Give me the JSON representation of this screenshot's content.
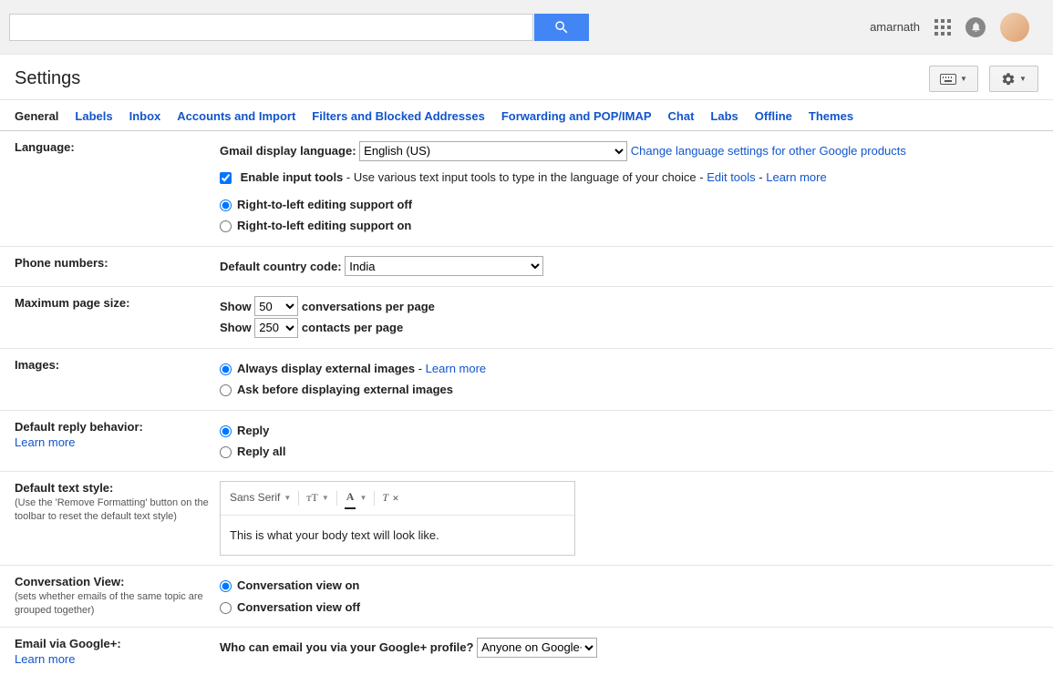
{
  "header": {
    "username": "amarnath"
  },
  "page": {
    "title": "Settings"
  },
  "tabs": [
    "General",
    "Labels",
    "Inbox",
    "Accounts and Import",
    "Filters and Blocked Addresses",
    "Forwarding and POP/IMAP",
    "Chat",
    "Labs",
    "Offline",
    "Themes"
  ],
  "language": {
    "label": "Language:",
    "display_label": "Gmail display language:",
    "display_value": "English (US)",
    "change_link": "Change language settings for other Google products",
    "enable_tools_label": "Enable input tools",
    "enable_tools_desc": " - Use various text input tools to type in the language of your choice - ",
    "edit_tools": "Edit tools",
    "learn_more": "Learn more",
    "rtl_off": "Right-to-left editing support off",
    "rtl_on": "Right-to-left editing support on"
  },
  "phone": {
    "label": "Phone numbers:",
    "default_label": "Default country code:",
    "value": "India"
  },
  "pagesize": {
    "label": "Maximum page size:",
    "show": "Show",
    "conv_value": "50",
    "conv_suffix": "conversations per page",
    "contacts_value": "250",
    "contacts_suffix": "contacts per page"
  },
  "images": {
    "label": "Images:",
    "always": "Always display external images",
    "learn_more": "Learn more",
    "ask": "Ask before displaying external images"
  },
  "reply": {
    "label": "Default reply behavior:",
    "learn_more": "Learn more",
    "reply": "Reply",
    "replyall": "Reply all"
  },
  "textstyle": {
    "label": "Default text style:",
    "sub": "(Use the 'Remove Formatting' button on the toolbar to reset the default text style)",
    "font": "Sans Serif",
    "preview": "This is what your body text will look like."
  },
  "conversation": {
    "label": "Conversation View:",
    "sub": "(sets whether emails of the same topic are grouped together)",
    "on": "Conversation view on",
    "off": "Conversation view off"
  },
  "gplus": {
    "label": "Email via Google+:",
    "learn_more": "Learn more",
    "question": "Who can email you via your Google+ profile?",
    "value": "Anyone on Google+"
  }
}
